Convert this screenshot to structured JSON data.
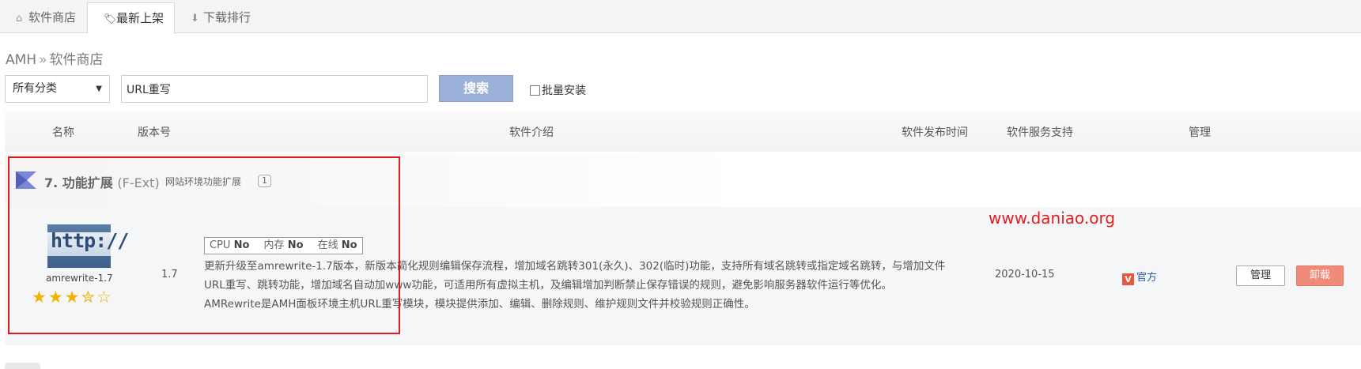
{
  "tabs": [
    {
      "label": "软件商店",
      "icon": "home-icon"
    },
    {
      "label": "最新上架",
      "icon": "tag-icon",
      "active": true
    },
    {
      "label": "下载排行",
      "icon": "download-arrow-icon"
    }
  ],
  "breadcrumb": {
    "root": "AMH",
    "separator": "»",
    "current": "软件商店"
  },
  "search": {
    "category": "所有分类",
    "query": "URL重写",
    "button": "搜索",
    "batch_install": "批量安装"
  },
  "table": {
    "headers": {
      "name": "名称",
      "version": "版本号",
      "intro": "软件介绍",
      "release": "软件发布时间",
      "support": "软件服务支持",
      "manage": "管理"
    }
  },
  "group": {
    "title": "7. 功能扩展",
    "en": "(F-Ext)",
    "subtitle": "网站环境功能扩展",
    "count": "1"
  },
  "item": {
    "logo_text": "http://",
    "name": "amrewrite-1.7",
    "rating": 3.5,
    "version": "1.7",
    "specs": {
      "cpu_label": "CPU",
      "cpu": "No",
      "mem_label": "内存",
      "mem": "No",
      "online_label": "在线",
      "online": "No"
    },
    "desc1": "更新升级至amrewrite-1.7版本，新版本简化规则编辑保存流程，增加域名跳转301(永久)、302(临时)功能，支持所有域名跳转或指定域名跳转，与增加文件URL重写、跳转功能，增加域名自动加www功能，可适用所有虚拟主机，及编辑增加判断禁止保存错误的规则，避免影响服务器软件运行等优化。",
    "desc2": "AMRewrite是AMH面板环境主机URL重写模块，模块提供添加、编辑、删除规则、维护规则文件并校验规则正确性。",
    "release_date": "2020-10-15",
    "support_badge": "V",
    "support": "官方",
    "manage_button": "管理",
    "uninstall_button": "卸载"
  },
  "watermark": "www.daniao.org",
  "colors": {
    "accent_button": "#9ab0d9",
    "uninstall": "#f08a7a",
    "highlight": "#e0191f",
    "watermark": "#e02020"
  }
}
